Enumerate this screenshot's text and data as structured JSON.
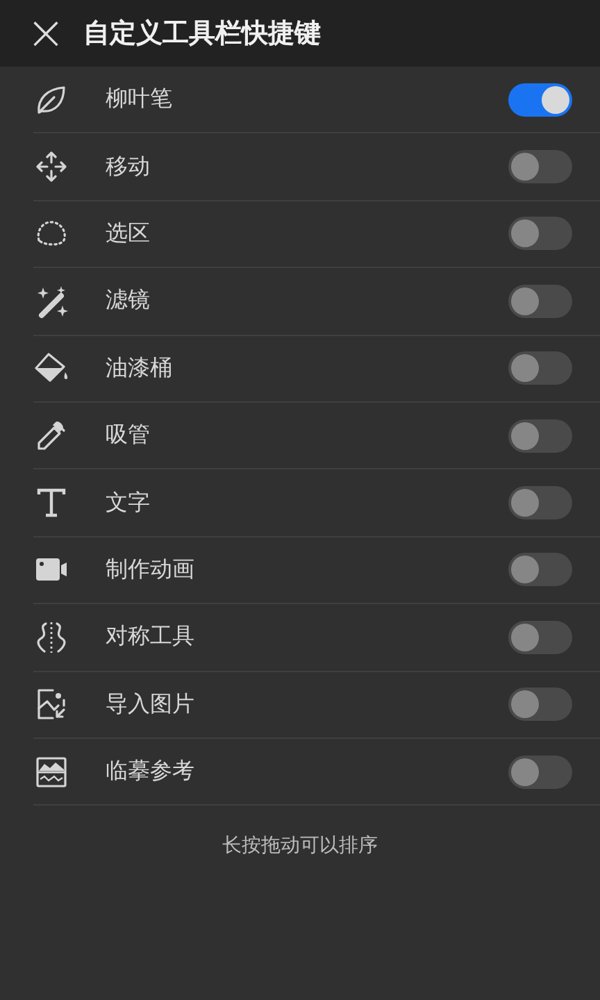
{
  "header": {
    "close": "×",
    "title": "自定义工具栏快捷键"
  },
  "tools": [
    {
      "label": "柳叶笔",
      "on": true
    },
    {
      "label": "移动",
      "on": false
    },
    {
      "label": "选区",
      "on": false
    },
    {
      "label": "滤镜",
      "on": false
    },
    {
      "label": "油漆桶",
      "on": false
    },
    {
      "label": "吸管",
      "on": false
    },
    {
      "label": "文字",
      "on": false
    },
    {
      "label": "制作动画",
      "on": false
    },
    {
      "label": "对称工具",
      "on": false
    },
    {
      "label": "导入图片",
      "on": false
    },
    {
      "label": "临摹参考",
      "on": false
    }
  ],
  "hint": "长按拖动可以排序"
}
